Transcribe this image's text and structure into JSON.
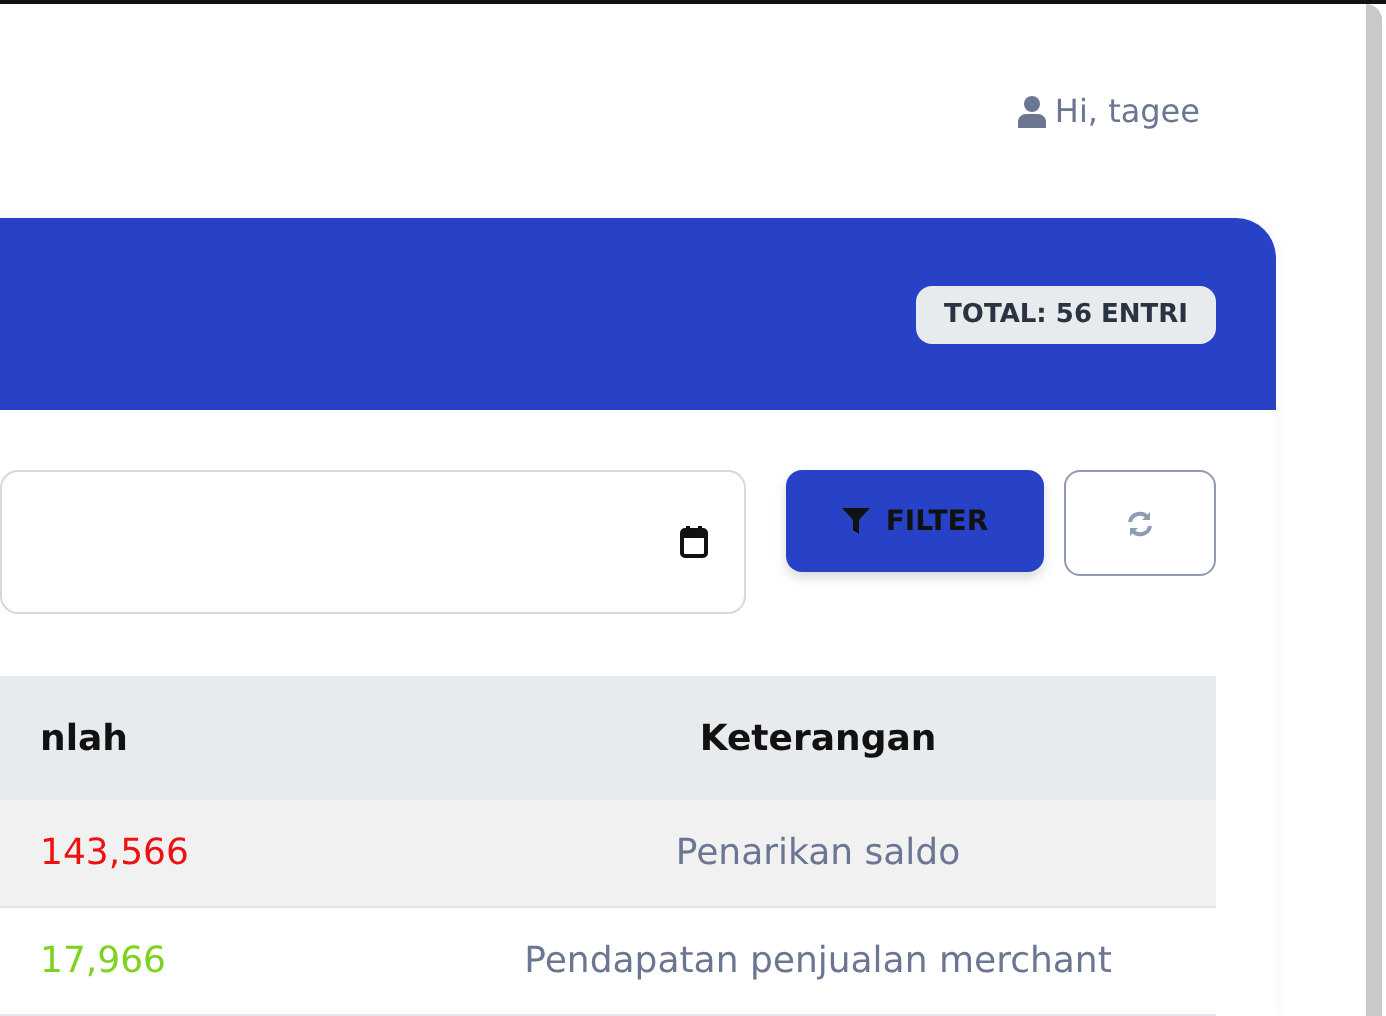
{
  "user_greeting": "Hi, tagee",
  "card": {
    "total_badge": "TOTAL: 56 ENTRI",
    "filter_button": "FILTER",
    "table": {
      "columns": [
        "nlah",
        "Keterangan"
      ],
      "rows": [
        {
          "amount": "143,566",
          "color": "#ee1111",
          "description": "Penarikan saldo"
        },
        {
          "amount": "17,966",
          "color": "#7ed321",
          "description": "Pendapatan penjualan merchant"
        }
      ]
    }
  }
}
